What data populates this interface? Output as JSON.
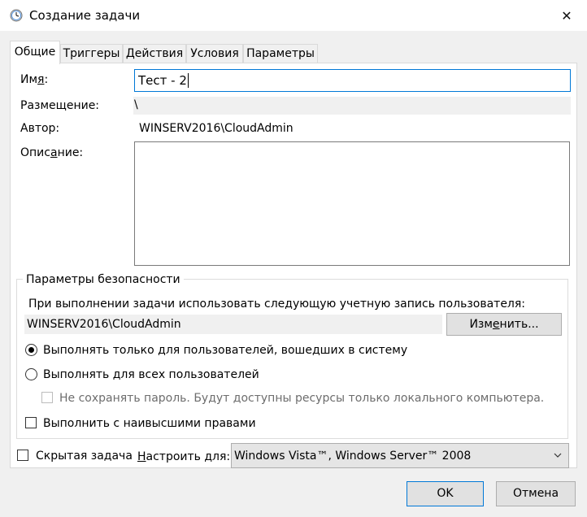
{
  "window": {
    "title": "Создание задачи",
    "close_glyph": "✕"
  },
  "tabs": [
    {
      "label": "Общие",
      "active": true
    },
    {
      "label": "Триггеры",
      "active": false
    },
    {
      "label": "Действия",
      "active": false
    },
    {
      "label": "Условия",
      "active": false
    },
    {
      "label": "Параметры",
      "active": false
    }
  ],
  "general": {
    "name_label_pre": "Им",
    "name_label_u": "я",
    "name_label_post": ":",
    "name_value": "Тест - 2",
    "location_label": "Размещение:",
    "location_value": "\\",
    "author_label": "Автор:",
    "author_value": "WINSERV2016\\CloudAdmin",
    "description_label_pre": "Опис",
    "description_label_u": "а",
    "description_label_post": "ние:",
    "description_value": ""
  },
  "security": {
    "group_title": "Параметры безопасности",
    "account_prompt": "При выполнении задачи использовать следующую учетную запись пользователя:",
    "account_value": "WINSERV2016\\CloudAdmin",
    "change_button_pre": "Изм",
    "change_button_u": "е",
    "change_button_post": "нить...",
    "option_logged_on": "Выполнять только для пользователей, вошедших в систему",
    "option_logged_on_selected": true,
    "option_all_users": "Выполнять для всех пользователей",
    "option_all_users_selected": false,
    "do_not_store_password": "Не сохранять пароль. Будут доступны ресурсы только локального компьютера.",
    "do_not_store_password_checked": false,
    "highest_privileges": "Выполнить с наивысшими правами",
    "highest_privileges_checked": false
  },
  "bottom": {
    "hidden_task_label": "Скрытая задача",
    "hidden_task_checked": false,
    "configure_for_label_pre": "",
    "configure_for_label_u": "Н",
    "configure_for_label_post": "астроить для:",
    "configure_for_value": "Windows Vista™, Windows Server™ 2008"
  },
  "buttons": {
    "ok": "OK",
    "cancel": "Отмена"
  },
  "colors": {
    "accent": "#0078d7",
    "panel_bg": "#ffffff",
    "window_bg": "#f0f0f0"
  }
}
